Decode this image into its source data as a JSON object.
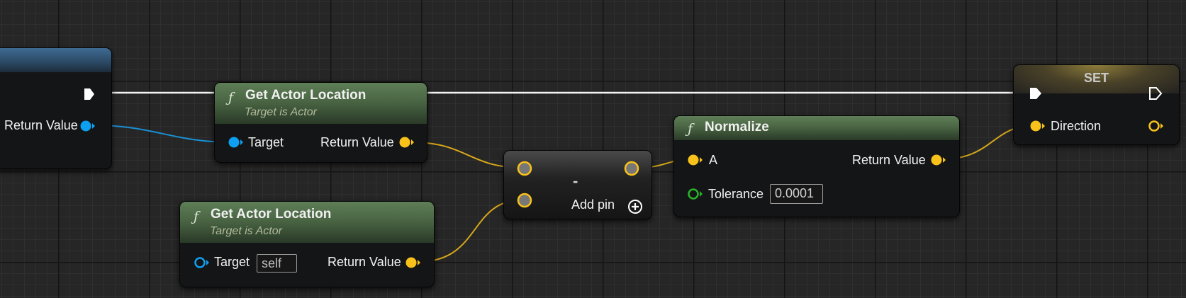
{
  "graph": {
    "left_node": {
      "return_label": "Return Value"
    },
    "get_loc_1": {
      "title": "Get Actor Location",
      "subtitle": "Target is Actor",
      "target_label": "Target",
      "return_label": "Return Value"
    },
    "get_loc_2": {
      "title": "Get Actor Location",
      "subtitle": "Target is Actor",
      "target_label": "Target",
      "target_value": "self",
      "return_label": "Return Value"
    },
    "subtract": {
      "symbol": "-",
      "add_pin_label": "Add pin"
    },
    "normalize": {
      "title": "Normalize",
      "a_label": "A",
      "return_label": "Return Value",
      "tolerance_label": "Tolerance",
      "tolerance_value": "0.0001"
    },
    "set_node": {
      "title": "SET",
      "direction_label": "Direction"
    },
    "icons": {
      "function": "ƒ",
      "exec": "exec-pin-icon",
      "object": "object-pin-icon",
      "vector": "vector-pin-icon",
      "float": "float-pin-icon",
      "add": "add-pin-icon"
    },
    "colors": {
      "exec_wire": "#ffffff",
      "object_pin": "#0ea0f0",
      "vector_pin": "#f9c21b",
      "float_pin": "#28b428",
      "function_header": "#4a6543",
      "variable_header": "#8c7b3a"
    }
  }
}
